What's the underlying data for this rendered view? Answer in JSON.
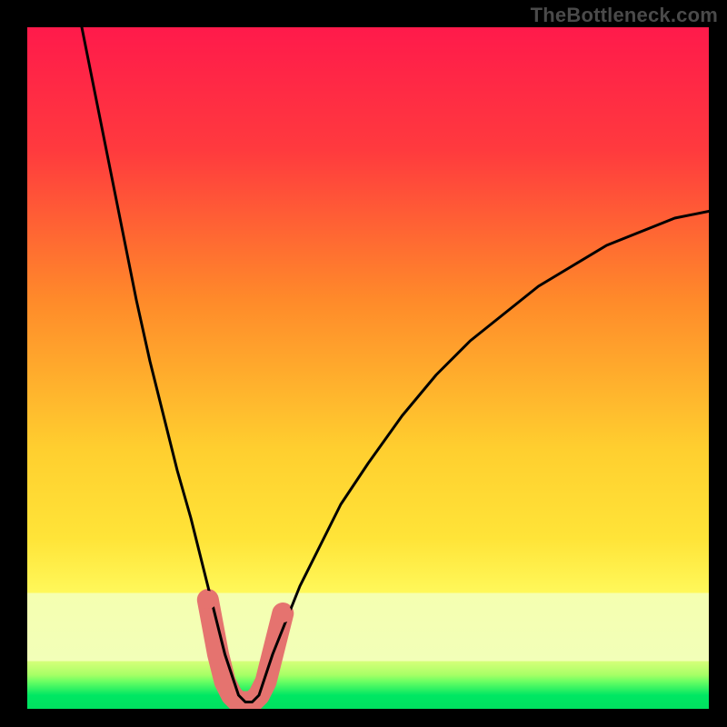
{
  "watermark": "TheBottleneck.com",
  "chart_data": {
    "type": "line",
    "title": "",
    "xlabel": "",
    "ylabel": "",
    "xlim": [
      0,
      100
    ],
    "ylim": [
      0,
      100
    ],
    "background_gradient": {
      "top": "#ff1a4b",
      "mid1": "#ff8a2a",
      "mid2": "#ffe438",
      "bottom_band": "#f5ffab",
      "green": "#00e763"
    },
    "series": [
      {
        "name": "bottleneck-curve",
        "color": "#000000",
        "x": [
          8,
          10,
          12,
          14,
          16,
          18,
          20,
          22,
          24,
          26,
          27,
          28,
          29,
          30,
          31,
          32,
          33,
          34,
          35,
          36,
          38,
          40,
          43,
          46,
          50,
          55,
          60,
          65,
          70,
          75,
          80,
          85,
          90,
          95,
          100
        ],
        "y": [
          100,
          90,
          80,
          70,
          60,
          51,
          43,
          35,
          28,
          20,
          16,
          12,
          8,
          5,
          2,
          1,
          1,
          2,
          5,
          8,
          13,
          18,
          24,
          30,
          36,
          43,
          49,
          54,
          58,
          62,
          65,
          68,
          70,
          72,
          73
        ]
      },
      {
        "name": "highlight-band",
        "color": "#e5736f",
        "points": [
          {
            "x": 26.5,
            "y": 16
          },
          {
            "x": 28,
            "y": 8
          },
          {
            "x": 29,
            "y": 4
          },
          {
            "x": 30,
            "y": 2
          },
          {
            "x": 31,
            "y": 1
          },
          {
            "x": 32,
            "y": 1
          },
          {
            "x": 33,
            "y": 1
          },
          {
            "x": 34,
            "y": 2
          },
          {
            "x": 35,
            "y": 4
          },
          {
            "x": 36,
            "y": 8
          },
          {
            "x": 37.5,
            "y": 14
          }
        ]
      }
    ]
  }
}
